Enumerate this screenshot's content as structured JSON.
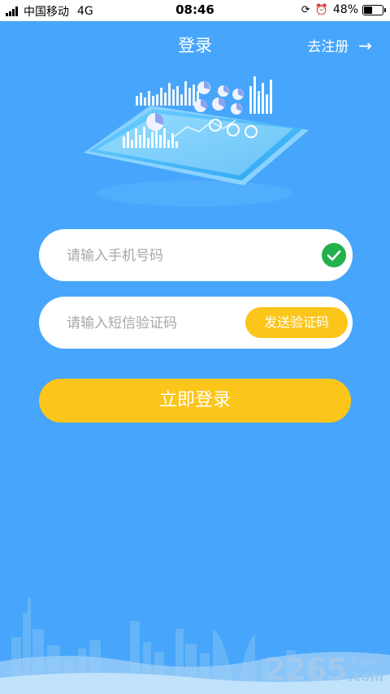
{
  "status_bar": {
    "carrier": "中国移动",
    "network": "4G",
    "time": "08:46",
    "battery": "48%",
    "battery_level": 0.48
  },
  "nav": {
    "title": "登录",
    "register_label": "去注册",
    "register_arrow": "→"
  },
  "form": {
    "phone_placeholder": "请输入手机号码",
    "phone_value": "",
    "code_placeholder": "请输入短信验证码",
    "code_value": "",
    "send_code_label": "发送验证码",
    "login_label": "立即登录"
  },
  "watermark": {
    "number": "2265",
    "site_cn": "手游网",
    "domain": ".com"
  },
  "colors": {
    "background": "#47a6fb",
    "accent_yellow": "#fbc51a",
    "check_green": "#22b14c"
  }
}
